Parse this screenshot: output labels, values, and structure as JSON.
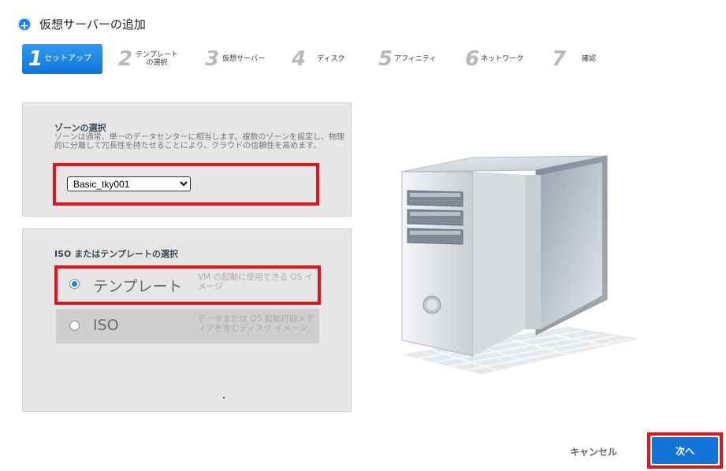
{
  "header": {
    "title": "仮想サーバーの追加",
    "icon": "plus-circle-icon"
  },
  "steps": [
    {
      "num": "1",
      "label": "セットアップ"
    },
    {
      "num": "2",
      "label": "テンプレート\nの選択"
    },
    {
      "num": "3",
      "label": "仮想サーバー"
    },
    {
      "num": "4",
      "label": "ディスク"
    },
    {
      "num": "5",
      "label": "アフィニティ"
    },
    {
      "num": "6",
      "label": "ネットワーク"
    },
    {
      "num": "7",
      "label": "確認"
    }
  ],
  "zone": {
    "heading": "ゾーンの選択",
    "description": "ゾーンは通常、単一のデータセンターに相当します。複数のゾーンを設定し、物理的に分離して冗長性を持たせることにより、クラウドの信頼性を高めます。",
    "selected": "Basic_tky001"
  },
  "iso": {
    "heading": "ISO またはテンプレートの選択",
    "options": [
      {
        "name": "テンプレート",
        "desc": "VM の起動に使用できる OS イメージ",
        "selected": true
      },
      {
        "name": "ISO",
        "desc": "データまたは OS 起動可能メディアを含むディスク イメージ",
        "selected": false
      }
    ]
  },
  "buttons": {
    "cancel": "キャンセル",
    "next": "次へ"
  },
  "colors": {
    "accent": "#1274d6",
    "highlight": "#e0141e"
  }
}
